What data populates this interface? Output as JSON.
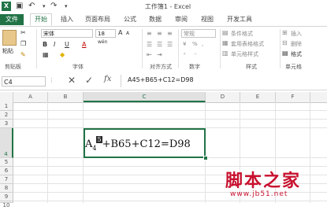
{
  "window": {
    "title": "工作簿1 - Excel",
    "app_badge": "X"
  },
  "quick_access": {
    "save_icon": "save-icon",
    "undo_icon": "undo-icon",
    "redo_icon": "redo-icon"
  },
  "tabs": [
    {
      "label": "文件"
    },
    {
      "label": "开始"
    },
    {
      "label": "插入"
    },
    {
      "label": "页面布局"
    },
    {
      "label": "公式"
    },
    {
      "label": "数据"
    },
    {
      "label": "审阅"
    },
    {
      "label": "视图"
    },
    {
      "label": "开发工具"
    }
  ],
  "ribbon": {
    "clipboard": {
      "paste": "粘贴",
      "label": "剪贴板"
    },
    "font": {
      "name": "宋体",
      "size": "18",
      "label": "字体",
      "bold": "B",
      "italic": "I",
      "underline": "U",
      "font_color": "A",
      "grow": "A",
      "shrink": "A",
      "wen": "wén"
    },
    "alignment": {
      "label": "对齐方式"
    },
    "number": {
      "format": "常规",
      "label": "数字",
      "percent": "%",
      "comma": ",",
      "currency": "¥"
    },
    "styles": {
      "conditional": "条件格式",
      "table_format": "套用表格格式",
      "cell_styles": "单元格样式",
      "label": "样式"
    },
    "cells": {
      "insert": "插入",
      "delete": "删除",
      "format": "格式",
      "label": "单元格"
    }
  },
  "formula_bar": {
    "name_box": "C4",
    "fx": "fx",
    "formula": "A45+B65+C12=D98"
  },
  "grid": {
    "columns": [
      "A",
      "B",
      "C",
      "D",
      "E",
      "F"
    ],
    "rows": [
      "1",
      "2",
      "3",
      "4",
      "5",
      "6",
      "7",
      "8",
      "9",
      "10"
    ],
    "cell_c4": {
      "base": "A",
      "sub": "4",
      "sup": "5",
      "rest": "+B65+C12=D98"
    }
  },
  "watermark": {
    "line1": "脚本之家",
    "line2": "www.jb51.net"
  }
}
